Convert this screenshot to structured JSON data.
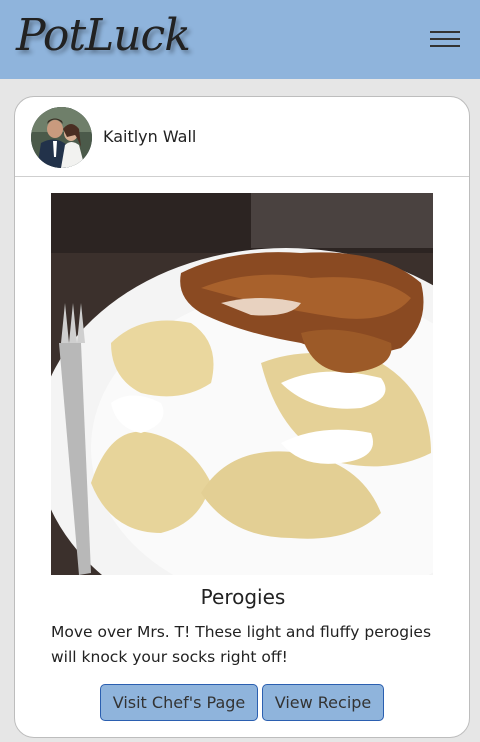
{
  "header": {
    "logo_text": "PotLuck",
    "menu_icon": "hamburger-menu-icon",
    "background": "#8fb4dc"
  },
  "post": {
    "chef_name": "Kaitlyn Wall",
    "dish_title": "Perogies",
    "description": "Move over Mrs. T! These light and fluffy perogies will knock your socks right off!",
    "visit_chef_label": "Visit Chef's Page",
    "view_recipe_label": "View Recipe",
    "photo_description": "Plate of perogies with sour cream and breaded chicken cutlet",
    "photo_alt": "Perogies"
  }
}
